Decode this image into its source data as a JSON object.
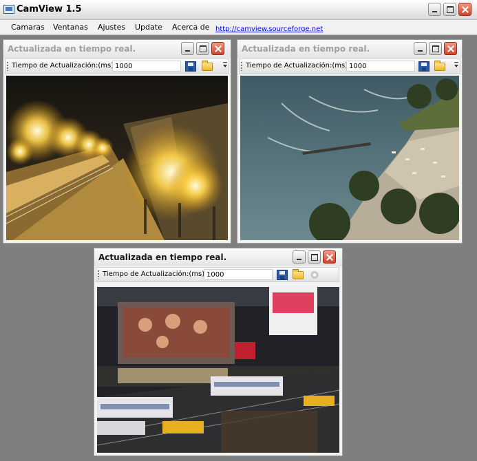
{
  "app": {
    "title": "CamView 1.5"
  },
  "menu": {
    "items": [
      "Camaras",
      "Ventanas",
      "Ajustes",
      "Update",
      "Acerca de"
    ],
    "link": "http://camview.sourceforge.net"
  },
  "windows": [
    {
      "title": "Actualizada en tiempo real.",
      "label": "Tiempo de Actualización:(ms)",
      "value": "1000",
      "active": false,
      "scene": "night-promenade"
    },
    {
      "title": "Actualizada en tiempo real.",
      "label": "Tiempo de Actualización:(ms)",
      "value": "1000",
      "active": false,
      "scene": "beach"
    },
    {
      "title": "Actualizada en tiempo real.",
      "label": "Tiempo de Actualización:(ms)",
      "value": "1000",
      "active": true,
      "scene": "times-square"
    }
  ],
  "icons": {
    "app": "camera-app-icon",
    "save": "save-icon",
    "open": "folder-open-icon",
    "settings": "gear-icon",
    "minimize": "minimize-icon",
    "maximize": "maximize-icon",
    "close": "close-icon"
  },
  "colors": {
    "desktop": "#7f7f7f",
    "close_button": "#d1432a",
    "link": "#0000ee"
  }
}
